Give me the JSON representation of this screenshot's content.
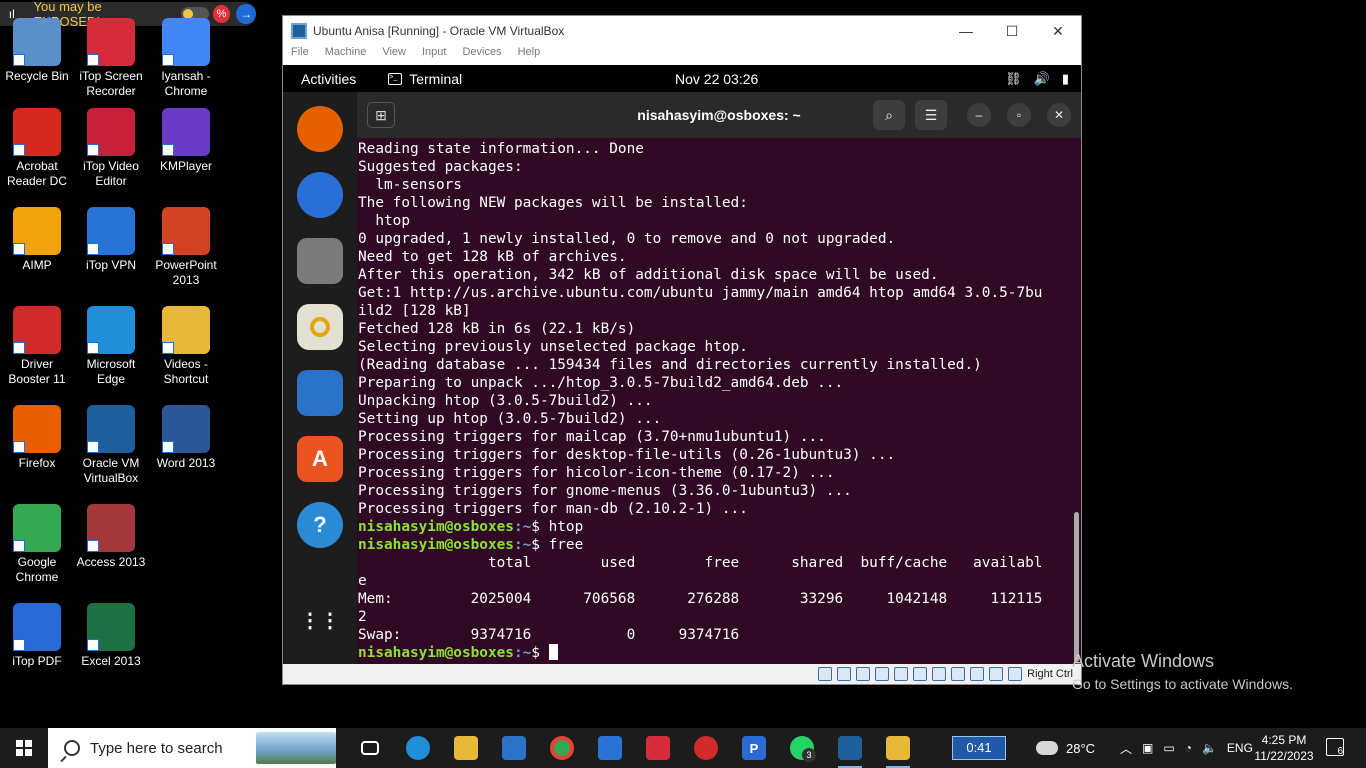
{
  "banner": {
    "text": "You may be EXPOSED!",
    "pct": "%",
    "arrow": "→"
  },
  "desktop_icons": [
    {
      "label": "Recycle Bin",
      "icon": "recycle-bin-icon",
      "color": "#5a8fc7"
    },
    {
      "label": "iTop Screen Recorder",
      "icon": "itop-screen-recorder-icon",
      "color": "#d62b3b"
    },
    {
      "label": "Iyansah - Chrome",
      "icon": "chrome-profile-icon",
      "color": "#4285f4"
    },
    {
      "label": "Acrobat Reader DC",
      "icon": "acrobat-icon",
      "color": "#d6281f"
    },
    {
      "label": "iTop Video Editor",
      "icon": "itop-video-editor-icon",
      "color": "#c8223a"
    },
    {
      "label": "KMPlayer",
      "icon": "kmplayer-icon",
      "color": "#6a3bc7"
    },
    {
      "label": "AIMP",
      "icon": "aimp-icon",
      "color": "#f2a20a"
    },
    {
      "label": "iTop VPN",
      "icon": "itop-vpn-icon",
      "color": "#2a73d6"
    },
    {
      "label": "PowerPoint 2013",
      "icon": "powerpoint-icon",
      "color": "#d04423"
    },
    {
      "label": "Driver Booster 11",
      "icon": "driver-booster-icon",
      "color": "#d12a2a"
    },
    {
      "label": "Microsoft Edge",
      "icon": "edge-icon",
      "color": "#1f8fd8"
    },
    {
      "label": "Videos - Shortcut",
      "icon": "videos-folder-icon",
      "color": "#e8b838"
    },
    {
      "label": "Firefox",
      "icon": "firefox-icon",
      "color": "#e66000"
    },
    {
      "label": "Oracle VM VirtualBox",
      "icon": "virtualbox-icon",
      "color": "#1f5f9b"
    },
    {
      "label": "Word 2013",
      "icon": "word-icon",
      "color": "#2b5797"
    },
    {
      "label": "Google Chrome",
      "icon": "chrome-icon",
      "color": "#34a853"
    },
    {
      "label": "Access 2013",
      "icon": "access-icon",
      "color": "#a4373a"
    },
    {
      "label": "iTop PDF",
      "icon": "itop-pdf-icon",
      "color": "#2a6ad6"
    },
    {
      "label": "Excel 2013",
      "icon": "excel-icon",
      "color": "#1e7145"
    }
  ],
  "vbox": {
    "title": "Ubuntu Anisa [Running] - Oracle VM VirtualBox",
    "menu": [
      "File",
      "Machine",
      "View",
      "Input",
      "Devices",
      "Help"
    ],
    "host_key": "Right Ctrl"
  },
  "gnome": {
    "activities": "Activities",
    "app": "Terminal",
    "clock": "Nov 22  03:26"
  },
  "terminal": {
    "title": "nisahasyim@osboxes: ~",
    "prompt_user": "nisahasyim@osboxes",
    "prompt_path": ":~",
    "lines": [
      "Reading state information... Done",
      "Suggested packages:",
      "  lm-sensors",
      "The following NEW packages will be installed:",
      "  htop",
      "0 upgraded, 1 newly installed, 0 to remove and 0 not upgraded.",
      "Need to get 128 kB of archives.",
      "After this operation, 342 kB of additional disk space will be used.",
      "Get:1 http://us.archive.ubuntu.com/ubuntu jammy/main amd64 htop amd64 3.0.5-7bu",
      "ild2 [128 kB]",
      "Fetched 128 kB in 6s (22.1 kB/s)",
      "Selecting previously unselected package htop.",
      "(Reading database ... 159434 files and directories currently installed.)",
      "Preparing to unpack .../htop_3.0.5-7build2_amd64.deb ...",
      "Unpacking htop (3.0.5-7build2) ...",
      "Setting up htop (3.0.5-7build2) ...",
      "Processing triggers for mailcap (3.70+nmu1ubuntu1) ...",
      "Processing triggers for desktop-file-utils (0.26-1ubuntu3) ...",
      "Processing triggers for hicolor-icon-theme (0.17-2) ...",
      "Processing triggers for gnome-menus (3.36.0-1ubuntu3) ...",
      "Processing triggers for man-db (2.10.2-1) ..."
    ],
    "cmd1": "$ htop",
    "cmd2": "$ free",
    "free_lines": [
      "               total        used        free      shared  buff/cache   availabl",
      "e",
      "Mem:         2025004      706568      276288       33296     1042148     112115",
      "2",
      "Swap:        9374716           0     9374716"
    ],
    "prompt_end": "$ "
  },
  "watermark": {
    "line1": "Activate Windows",
    "line2": "Go to Settings to activate Windows."
  },
  "taskbar": {
    "search_placeholder": "Type here to search",
    "timer": "0:41",
    "temperature": "28°C",
    "lang": "ENG",
    "time": "4:25 PM",
    "date": "11/22/2023",
    "whatsapp_badge": "3",
    "notif_count": "6"
  }
}
